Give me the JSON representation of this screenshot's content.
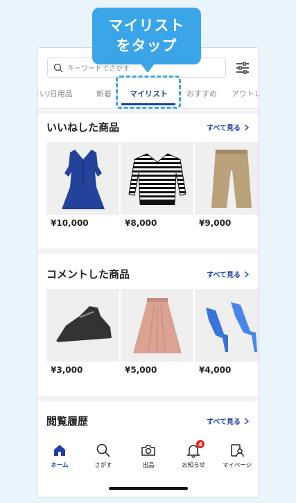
{
  "callout": {
    "line1": "マイリスト",
    "line2": "をタップ"
  },
  "search": {
    "placeholder": "キーワードでさがす"
  },
  "tabs": [
    {
      "label": "まい/日用品"
    },
    {
      "label": "新着"
    },
    {
      "label": "マイリスト",
      "active": true
    },
    {
      "label": "おすすめ"
    },
    {
      "label": "アウトレ"
    }
  ],
  "sections": [
    {
      "title": "いいねした商品",
      "see_all": "すべて見る",
      "items": [
        {
          "price": "¥10,000",
          "icon": "dress"
        },
        {
          "price": "¥8,000",
          "icon": "striped-sweater"
        },
        {
          "price": "¥9,000",
          "icon": "khaki-pants"
        }
      ]
    },
    {
      "title": "コメントした商品",
      "see_all": "すべて見る",
      "items": [
        {
          "price": "¥3,000",
          "icon": "sneaker"
        },
        {
          "price": "¥5,000",
          "icon": "pink-skirt"
        },
        {
          "price": "¥4,000",
          "icon": "blue-heels"
        }
      ]
    },
    {
      "title": "閲覧履歴",
      "see_all": "すべて見る"
    }
  ],
  "bottom_nav": [
    {
      "label": "ホーム",
      "icon": "home-icon",
      "active": true
    },
    {
      "label": "さがす",
      "icon": "search-icon"
    },
    {
      "label": "出品",
      "icon": "camera-icon"
    },
    {
      "label": "お知らせ",
      "icon": "bell-icon",
      "badge": "4"
    },
    {
      "label": "マイページ",
      "icon": "profile-icon"
    }
  ],
  "colors": {
    "accent": "#1f3fa6",
    "callout": "#3aa5e8",
    "badge": "#e12828"
  }
}
